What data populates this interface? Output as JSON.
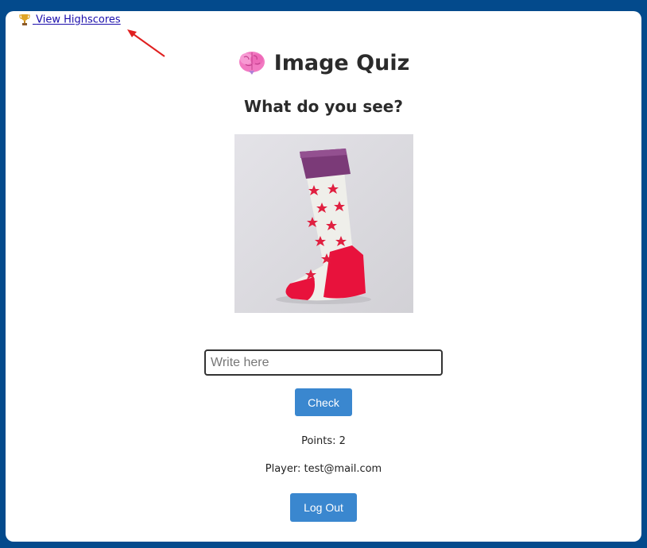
{
  "nav": {
    "highscores_label": "View Highscores",
    "trophy_icon": "trophy-icon"
  },
  "header": {
    "title": "Image Quiz",
    "brain_icon": "brain-icon"
  },
  "quiz": {
    "question": "What do you see?",
    "image_subject": "sock"
  },
  "answer": {
    "placeholder": "Write here",
    "value": ""
  },
  "buttons": {
    "check_label": "Check",
    "logout_label": "Log Out"
  },
  "status": {
    "points_text": "Points: 2",
    "player_text": "Player: test@mail.com"
  },
  "colors": {
    "page_background": "#034a8c",
    "button": "#3a87cf",
    "link": "#1a0dab"
  }
}
